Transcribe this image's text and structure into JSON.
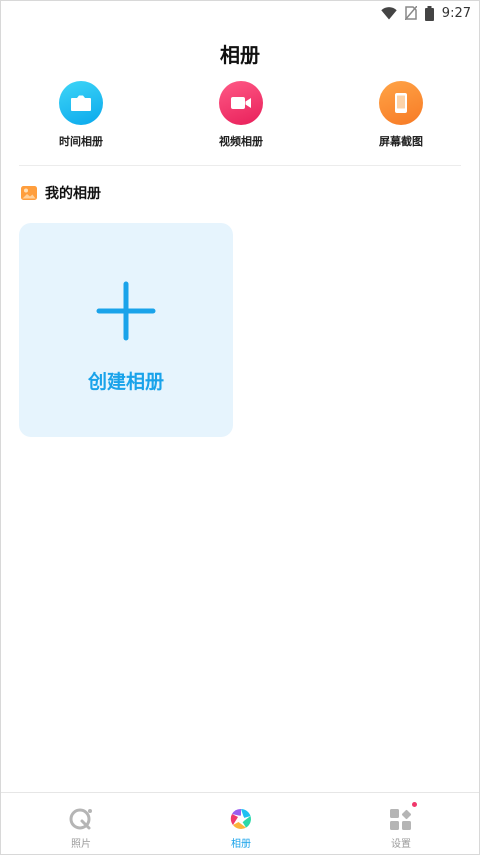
{
  "status_bar": {
    "time": "9:27"
  },
  "page": {
    "title": "相册"
  },
  "shortcuts": [
    {
      "label": "时间相册",
      "icon": "camera-icon",
      "color": "#1ec0f2"
    },
    {
      "label": "视频相册",
      "icon": "video-icon",
      "color": "#f0386b"
    },
    {
      "label": "屏幕截图",
      "icon": "phone-icon",
      "color": "#fb8a33"
    }
  ],
  "my_albums": {
    "title": "我的相册",
    "create_label": "创建相册"
  },
  "bottom_nav": [
    {
      "label": "照片",
      "icon": "photos-icon",
      "active": false
    },
    {
      "label": "相册",
      "icon": "album-aperture-icon",
      "active": true
    },
    {
      "label": "设置",
      "icon": "settings-grid-icon",
      "active": false
    }
  ],
  "colors": {
    "accent": "#1aa3ea",
    "card_bg": "#e6f4fd"
  }
}
